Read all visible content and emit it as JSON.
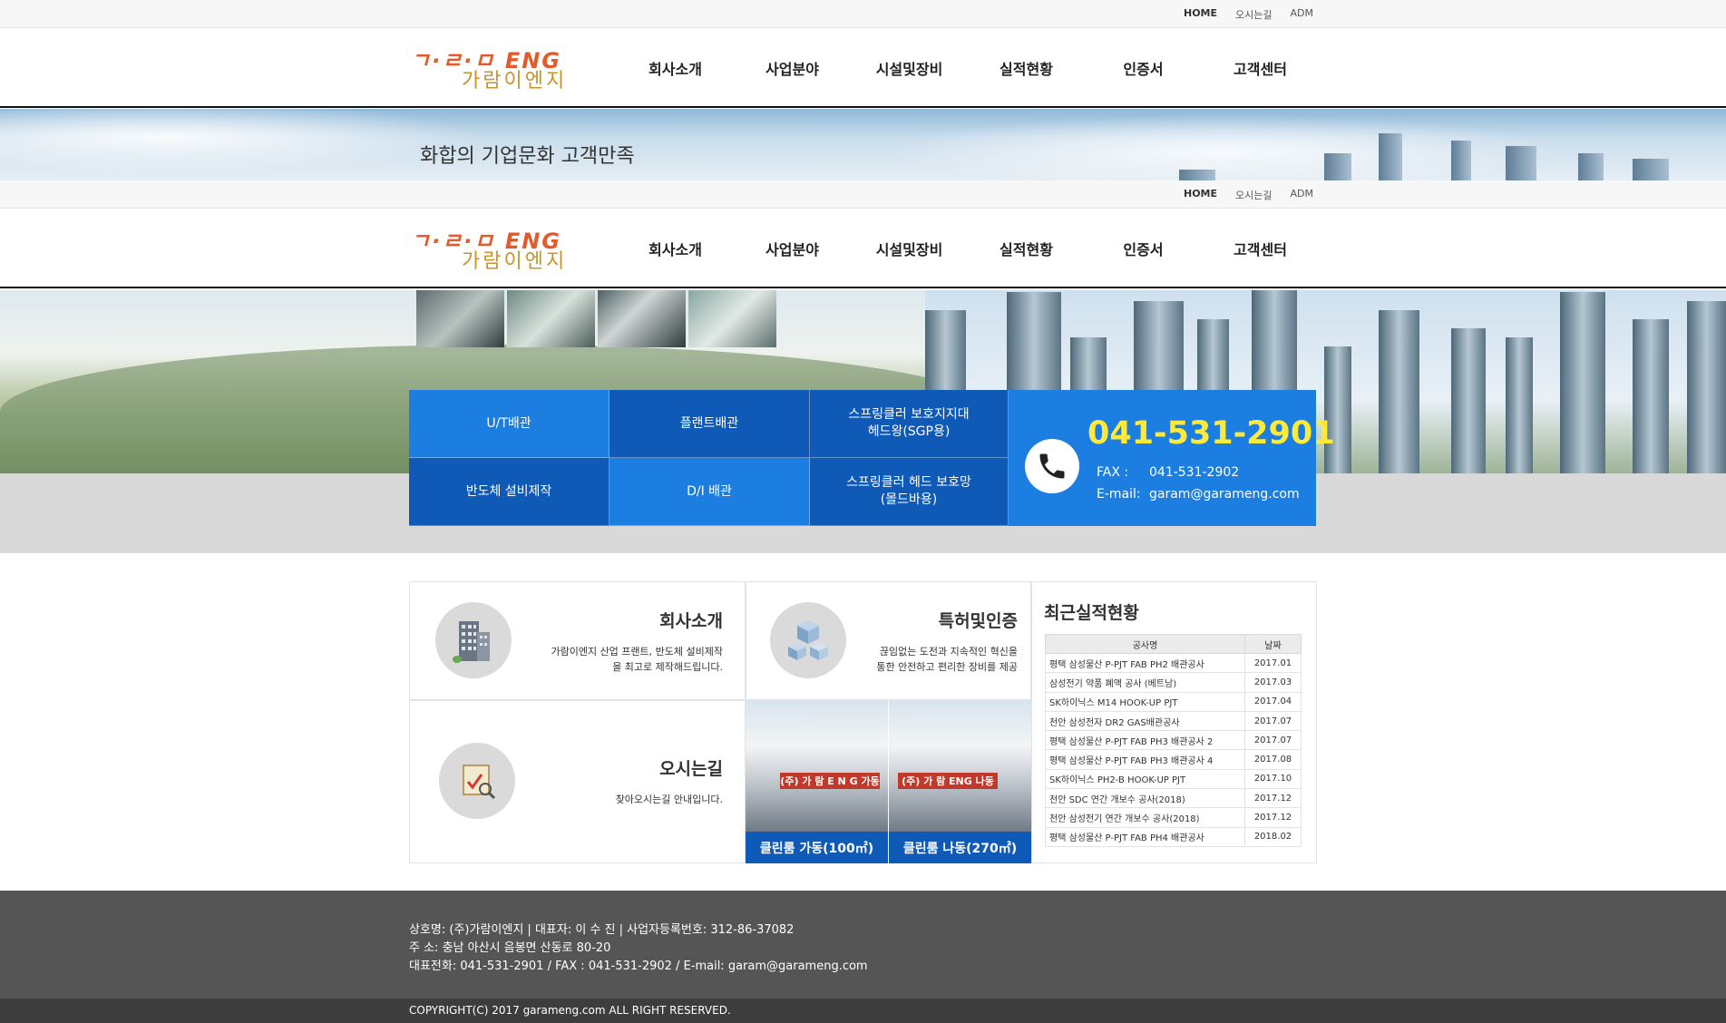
{
  "util": {
    "home": "HOME",
    "directions": "오시는길",
    "adm": "ADM"
  },
  "logo": {
    "eng": "ㄱ·ㄹ·ㅁ ENG",
    "kor": "가람이엔지"
  },
  "nav": [
    "회사소개",
    "사업분야",
    "시설및장비",
    "실적현황",
    "인증서",
    "고객센터"
  ],
  "banner": {
    "slogan": "화합의 기업문화 고객만족"
  },
  "quick_menu": [
    {
      "label": "U/T배관",
      "tone": "light"
    },
    {
      "label": "플랜트배관",
      "tone": "dark"
    },
    {
      "label": "스프링클러 보호지지대\n헤드왕(SGP용)",
      "tone": "dark"
    },
    {
      "label": "반도체 설비제작",
      "tone": "dark"
    },
    {
      "label": "D/I 배관",
      "tone": "light"
    },
    {
      "label": "스프링클러 헤드 보호망\n(몰드바용)",
      "tone": "dark"
    }
  ],
  "contact": {
    "phone": "041-531-2901",
    "fax_label": "FAX   :",
    "fax": "041-531-2902",
    "email_label": "E-mail:",
    "email": "garam@garameng.com"
  },
  "company": {
    "title": "회사소개",
    "desc1": "가람이엔지 산업 프랜트, 반도체 설비제작",
    "desc2": "을 최고로 제작해드립니다."
  },
  "patent": {
    "title": "특허및인증",
    "desc1": "끊임없는 도전과 지속적인 혁신을",
    "desc2": "통한 안전하고 편리한 장비를 제공"
  },
  "directions": {
    "title": "오시는길",
    "desc": "찾아오시는길 안내입니다."
  },
  "cleanrooms": [
    {
      "sign": "(주) 가 람  E N G  가동",
      "caption": "클린룸 가동(100㎡)"
    },
    {
      "sign": "(주) 가 람 ENG  나동",
      "caption": "클린룸 나동(270㎡)"
    }
  ],
  "recent": {
    "title": "최근실적현황",
    "headers": [
      "공사명",
      "날짜"
    ],
    "rows": [
      [
        "평택 삼성물산 P-PJT FAB PH2 배관공사",
        "2017.01"
      ],
      [
        "삼성전기 약품 폐액 공사 (베트남)",
        "2017.03"
      ],
      [
        "SK하이닉스 M14 HOOK-UP PJT",
        "2017.04"
      ],
      [
        "천안 삼성전자 DR2 GAS배관공사",
        "2017.07"
      ],
      [
        "평택 삼성물산 P-PJT FAB PH3 배관공사 2",
        "2017.07"
      ],
      [
        "평택 삼성물산 P-PJT FAB PH3 배관공사 4",
        "2017.08"
      ],
      [
        "SK하이닉스 PH2-B HOOK-UP PJT",
        "2017.10"
      ],
      [
        "천안 SDC 연간 개보수 공사(2018)",
        "2017.12"
      ],
      [
        "천안 삼성전기 연간 개보수 공사(2018)",
        "2017.12"
      ],
      [
        "평택 삼성물산 P-PJT FAB PH4 배관공사",
        "2018.02"
      ]
    ]
  },
  "footer": {
    "line1": "상호명: (주)가람이엔지   |  대표자: 이 수 진   |  사업자등록번호: 312-86-37082",
    "line2": "주    소: 충남 아산시 음봉면 산동로 80-20",
    "line3": "대표전화: 041-531-2901 / FAX : 041-531-2902 / E-mail: garam@garameng.com",
    "copyright": "COPYRIGHT(C) 2017 garameng.com ALL RIGHT RESERVED."
  },
  "colors": {
    "accent_light": "#1c7ee0",
    "accent_dark": "#0f5ab6",
    "phone": "#ffea3a",
    "footer": "#555555"
  }
}
